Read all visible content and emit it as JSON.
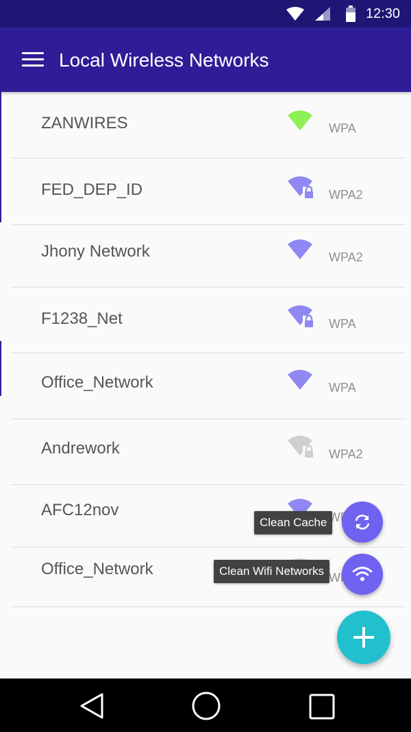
{
  "status_bar": {
    "time": "12:30"
  },
  "app_bar": {
    "title": "Local Wireless Networks"
  },
  "networks": [
    {
      "name": "ZANWIRES",
      "security": "WPA",
      "signal_color": "#8ef056",
      "locked": false
    },
    {
      "name": "FED_DEP_ID",
      "security": "WPA2",
      "signal_color": "#8f87f3",
      "locked": true
    },
    {
      "name": "Jhony Network",
      "security": "WPA2",
      "signal_color": "#8f87f3",
      "locked": false
    },
    {
      "name": "F1238_Net",
      "security": "WPA",
      "signal_color": "#8f87f3",
      "locked": true
    },
    {
      "name": "Office_Network",
      "security": "WPA",
      "signal_color": "#8f87f3",
      "locked": false
    },
    {
      "name": "Andrework",
      "security": "WPA2",
      "signal_color": "#cfcfcf",
      "locked": true
    },
    {
      "name": "AFC12nov",
      "security": "WPA",
      "signal_color": "#8f87f3",
      "locked": false
    },
    {
      "name": "Office_Network",
      "security": "WPA",
      "signal_color": "#cfcfcf",
      "locked": true
    }
  ],
  "fab_menu": {
    "clean_cache_label": "Clean Cache",
    "clean_wifi_label": "Clean Wifi Networks",
    "mini_fab_color": "#6f62f0",
    "main_fab_color": "#22c0cf"
  },
  "colors": {
    "status_bar": "#201575",
    "app_bar": "#2e1d97",
    "background": "#fafafa"
  }
}
